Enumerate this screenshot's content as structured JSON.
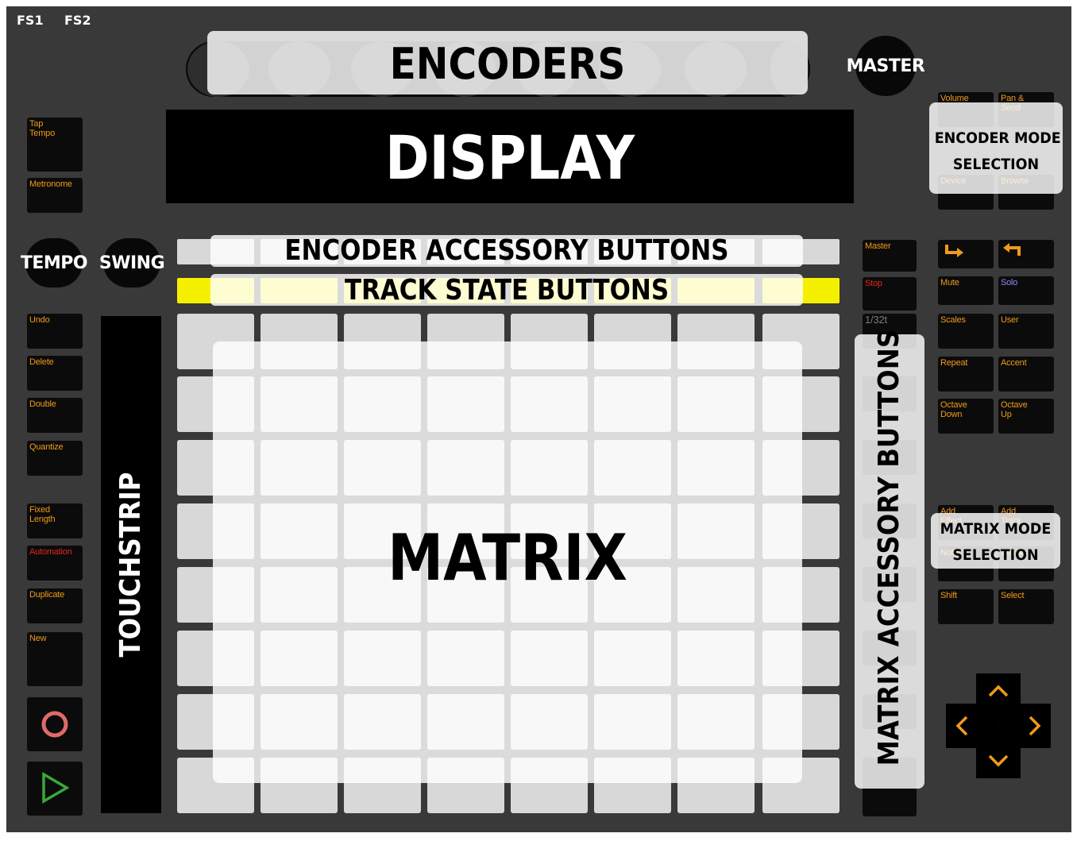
{
  "footswitches": [
    "FS1",
    "FS2"
  ],
  "encoders_label": "ENCODERS",
  "master_label": "MASTER",
  "display_label": "DISPLAY",
  "tempo_label": "TEMPO",
  "swing_label": "SWING",
  "encoder_accessory_label": "ENCODER ACCESSORY BUTTONS",
  "track_state_label": "TRACK STATE BUTTONS",
  "matrix_label": "MATRIX",
  "matrix_accessory_label": "MATRIX ACCESSORY BUTTONS",
  "touchstrip_label": "TOUCHSTRIP",
  "encoder_mode_label": [
    "ENCODER MODE",
    "SELECTION"
  ],
  "matrix_mode_label": [
    "MATRIX MODE",
    "SELECTION"
  ],
  "left_buttons": {
    "tap_tempo": "Tap\nTempo",
    "metronome": "Metronome",
    "undo": "Undo",
    "delete": "Delete",
    "double": "Double",
    "quantize": "Quantize",
    "fixed_length": "Fixed\nLength",
    "automation": "Automation",
    "duplicate": "Duplicate",
    "new": "New"
  },
  "right_acc_buttons": {
    "master": "Master",
    "stop": "Stop",
    "one_32t": "1/32t"
  },
  "encoder_mode_buttons": {
    "volume": "Volume",
    "pan_send": "Pan &\nSend",
    "device": "Device",
    "browse": "Browse"
  },
  "right_buttons": {
    "mute": "Mute",
    "solo": "Solo",
    "scales": "Scales",
    "user": "User",
    "repeat": "Repeat",
    "accent": "Accent",
    "octave_down": "Octave\nDown",
    "octave_up": "Octave\nUp",
    "add_effect": "Add\nEffect",
    "add_track": "Add\nTrack",
    "note": "Note",
    "session": "Session",
    "shift": "Shift",
    "select": "Select"
  },
  "colors": {
    "device_bg": "#393939",
    "button_bg": "#0b0b0b",
    "label_orange": "#f09a1a",
    "automation_red": "#e8241a",
    "solo_blue": "#8c8cff",
    "track_state_yellow": "#f5f000",
    "pad_grey": "#d8d8d8",
    "record_circle": "#e06a6a",
    "play_triangle": "#3aa83a"
  },
  "icons": {
    "record": "circle-outline",
    "play": "triangle-right-outline",
    "new_line": "arrow-down-right",
    "undo_arrow": "arrow-return-left",
    "dpad": [
      "chevron-up",
      "chevron-left",
      "chevron-right",
      "chevron-down"
    ]
  }
}
